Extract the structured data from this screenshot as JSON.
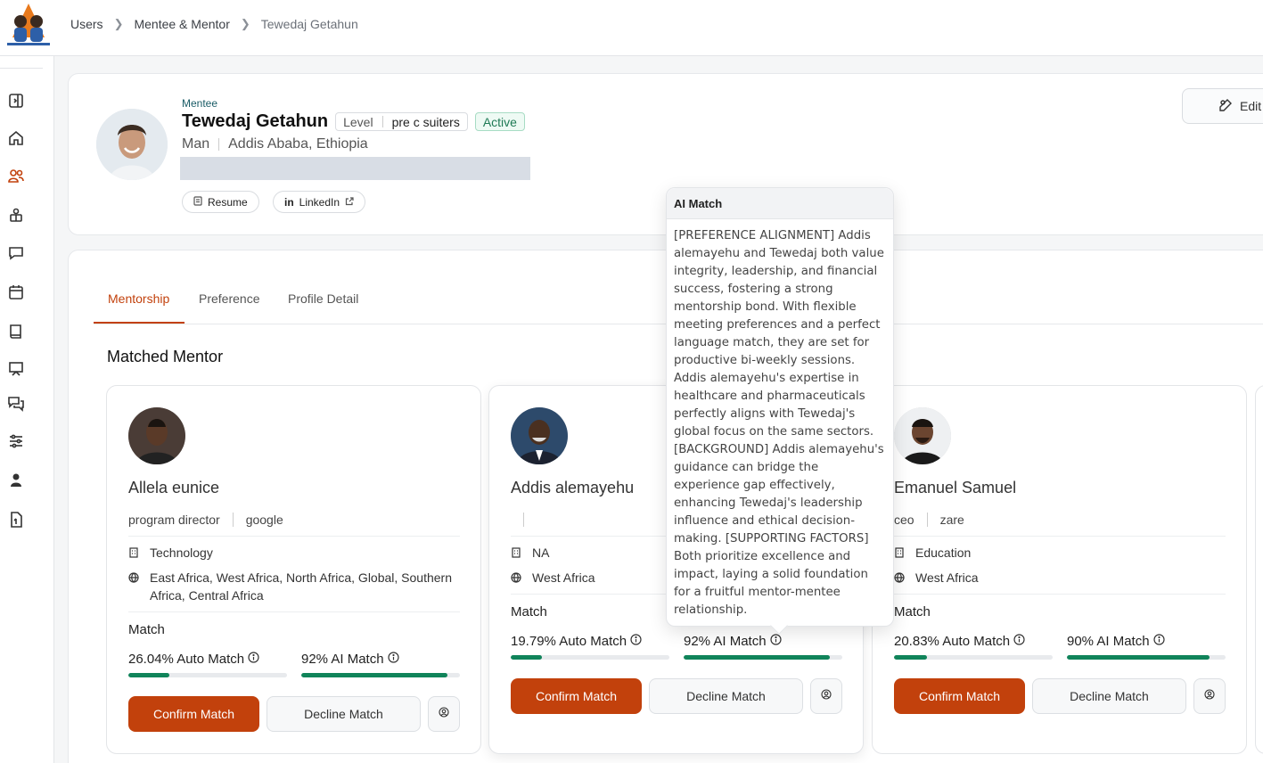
{
  "breadcrumb": [
    "Users",
    "Mentee & Mentor",
    "Tewedaj Getahun"
  ],
  "profile": {
    "role": "Mentee",
    "name": "Tewedaj Getahun",
    "level_label": "Level",
    "level_value": "pre c suiters",
    "status": "Active",
    "gender": "Man",
    "location": "Addis Ababa, Ethiopia",
    "resume_label": "Resume",
    "linkedin_label": "LinkedIn",
    "edit_label": "Edit"
  },
  "tabs": [
    "Mentorship",
    "Preference",
    "Profile Detail"
  ],
  "section_title": "Matched Mentor",
  "mentors": [
    {
      "name": "Allela eunice",
      "title": "program director",
      "company": "google",
      "industry": "Technology",
      "regions": "East Africa, West Africa, North Africa, Global, Southern Africa, Central Africa",
      "match_label": "Match",
      "auto_match": "26.04% Auto Match",
      "auto_match_value": 26.04,
      "ai_match": "92% AI Match",
      "ai_match_value": 92,
      "confirm": "Confirm Match",
      "decline": "Decline Match"
    },
    {
      "name": "Addis alemayehu",
      "title": "",
      "company": "",
      "industry": "NA",
      "regions": "West Africa",
      "match_label": "Match",
      "auto_match": "19.79% Auto Match",
      "auto_match_value": 19.79,
      "ai_match": "92% AI Match",
      "ai_match_value": 92,
      "confirm": "Confirm Match",
      "decline": "Decline Match"
    },
    {
      "name": "Emanuel Samuel",
      "title": "ceo",
      "company": "zare",
      "industry": "Education",
      "regions": "West Africa",
      "match_label": "Match",
      "auto_match": "20.83% Auto Match",
      "auto_match_value": 20.83,
      "ai_match": "90% AI Match",
      "ai_match_value": 90,
      "confirm": "Confirm Match",
      "decline": "Decline Match"
    }
  ],
  "tooltip": {
    "title": "AI Match",
    "body": "[PREFERENCE ALIGNMENT] Addis alemayehu and Tewedaj both value integrity, leadership, and financial success, fostering a strong mentorship bond. With flexible meeting preferences and a perfect language match, they are set for productive bi-weekly sessions. Addis alemayehu's expertise in healthcare and pharmaceuticals perfectly aligns with Tewedaj's global focus on the same sectors. [BACKGROUND] Addis alemayehu's guidance can bridge the experience gap effectively, enhancing Tewedaj's leadership influence and ethical decision-making. [SUPPORTING FACTORS] Both prioritize excellence and impact, laying a solid foundation for a fruitful mentor-mentee relationship."
  },
  "colors": {
    "accent": "#c2410c",
    "progress": "#10845a",
    "active_badge": "#1f7a55"
  },
  "icons": [
    "collapse-sidebar-icon",
    "home-icon",
    "users-icon",
    "mentorship-icon",
    "chat-icon",
    "calendar-icon",
    "book-icon",
    "report-icon",
    "messages-icon",
    "settings-sliders-icon",
    "person-icon",
    "document-icon"
  ]
}
